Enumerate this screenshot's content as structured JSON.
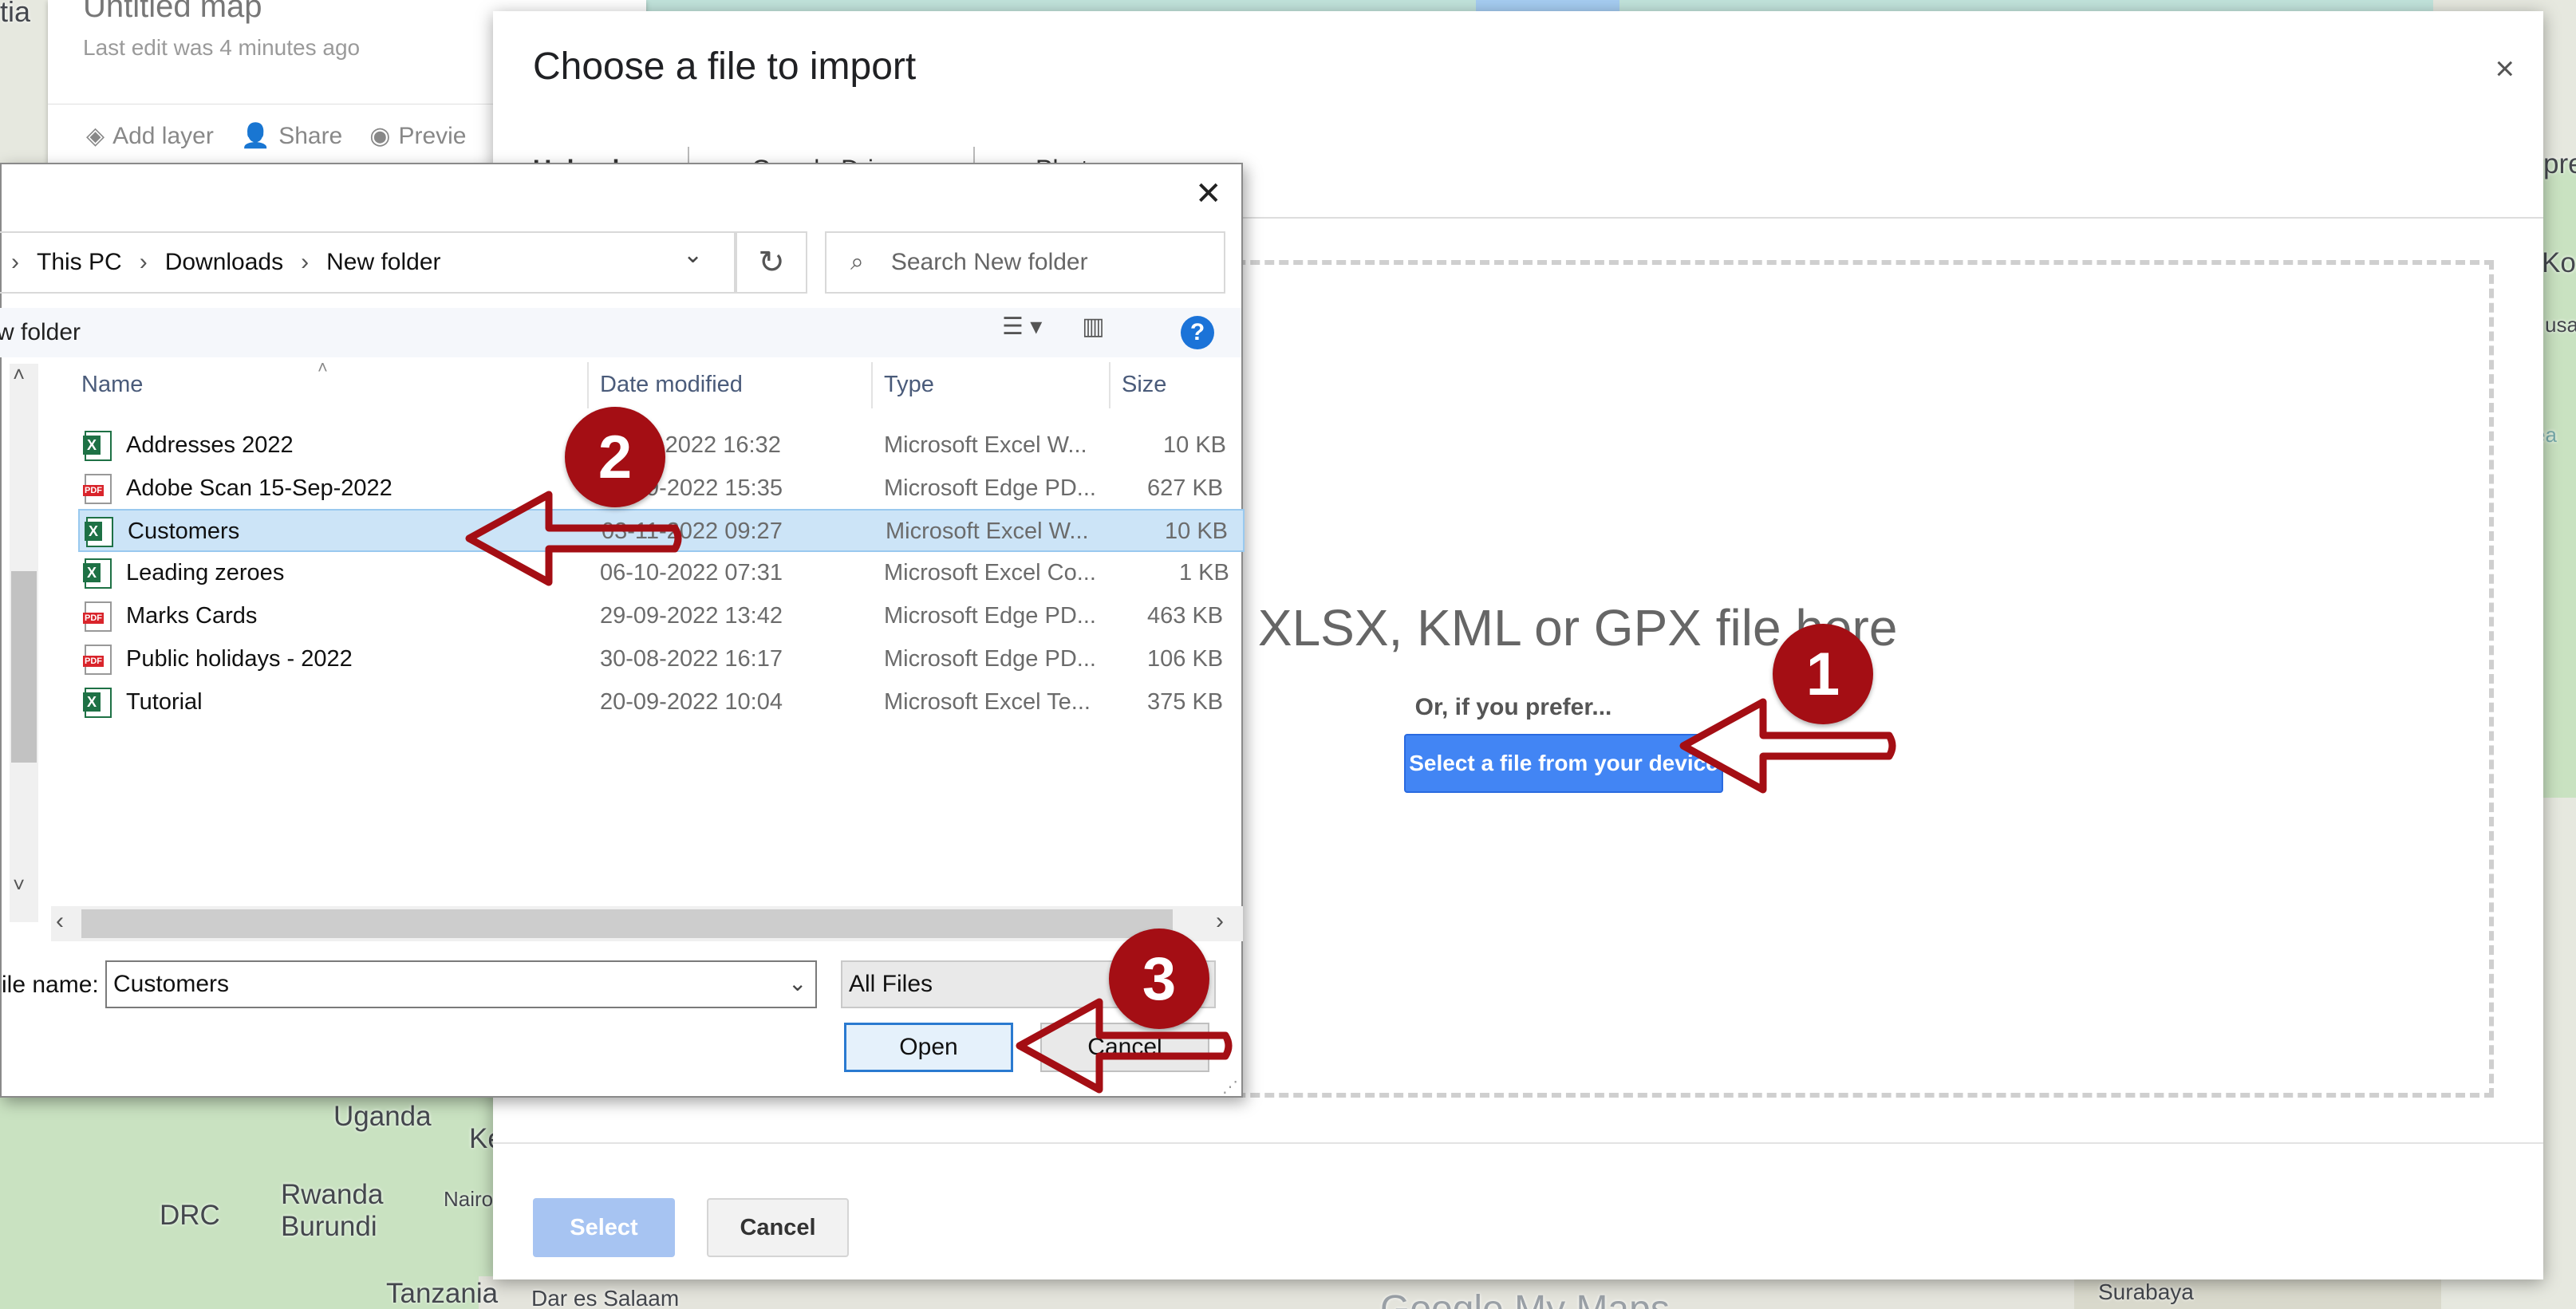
{
  "map": {
    "labels": [
      "Uganda",
      "Rwanda",
      "Burundi",
      "DRC",
      "Tanzania",
      "Dar es Salaam",
      "Nairobi",
      "Ke",
      "Surabaya",
      "Google My Maps",
      "tia",
      "pre",
      "Kor",
      "usa",
      "ea"
    ]
  },
  "side_panel": {
    "title": "Untitled map",
    "subtitle": "Last edit was 4 minutes ago",
    "tools": [
      "Add layer",
      "Share",
      "Previe"
    ]
  },
  "import_dialog": {
    "title": "Choose a file to import",
    "close": "×",
    "tabs": [
      "Upload",
      "Google Drive",
      "Photos"
    ],
    "drop_text": "CSV, XLSX, KML or GPX file here",
    "prefer": "Or, if you prefer...",
    "select_device": "Select a file from your device",
    "select_btn": "Select",
    "cancel_btn": "Cancel"
  },
  "file_dialog": {
    "close": "✕",
    "path": [
      "This PC",
      "Downloads",
      "New folder"
    ],
    "search_placeholder": "Search New folder",
    "crumb": "w folder",
    "columns": [
      "Name",
      "Date modified",
      "Type",
      "Size"
    ],
    "files": [
      {
        "name": "Addresses 2022",
        "date": "03-11-2022 16:32",
        "type": "Microsoft Excel W...",
        "size": "10 KB",
        "icon": "excel-icon"
      },
      {
        "name": "Adobe Scan 15-Sep-2022",
        "date": "15-09-2022 15:35",
        "type": "Microsoft Edge PD...",
        "size": "627 KB",
        "icon": "pdf-icon"
      },
      {
        "name": "Customers",
        "date": "03-11-2022 09:27",
        "type": "Microsoft Excel W...",
        "size": "10 KB",
        "icon": "excel-icon"
      },
      {
        "name": "Leading zeroes",
        "date": "06-10-2022 07:31",
        "type": "Microsoft Excel Co...",
        "size": "1 KB",
        "icon": "excel-icon"
      },
      {
        "name": "Marks Cards",
        "date": "29-09-2022 13:42",
        "type": "Microsoft Edge PD...",
        "size": "463 KB",
        "icon": "pdf-icon"
      },
      {
        "name": "Public holidays - 2022",
        "date": "30-08-2022 16:17",
        "type": "Microsoft Edge PD...",
        "size": "106 KB",
        "icon": "pdf-icon"
      },
      {
        "name": "Tutorial",
        "date": "20-09-2022 10:04",
        "type": "Microsoft Excel Te...",
        "size": "375 KB",
        "icon": "excel-icon"
      }
    ],
    "selected_index": 2,
    "file_name_label": "ile name:",
    "file_name_value": "Customers",
    "filter": "All Files",
    "open_btn": "Open",
    "cancel_btn": "Cancel"
  },
  "annotations": {
    "badges": [
      "1",
      "2",
      "3"
    ],
    "color": "#a40e14"
  }
}
